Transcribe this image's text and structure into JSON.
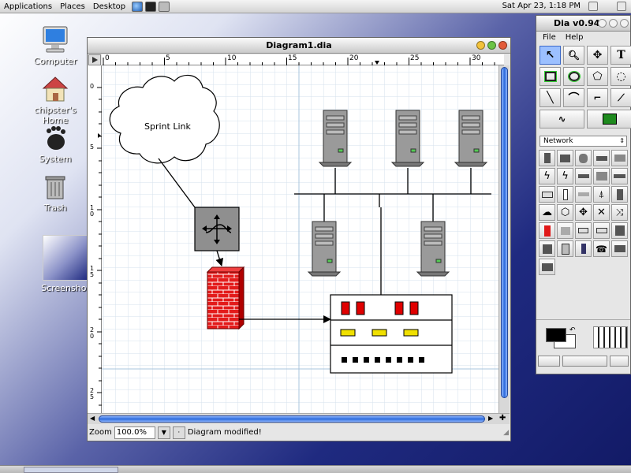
{
  "panel": {
    "menus": [
      "Applications",
      "Places",
      "Desktop"
    ],
    "clock": "Sat Apr 23,  1:18 PM"
  },
  "desktop_icons": [
    {
      "label": "Computer"
    },
    {
      "label": "chipster's Home"
    },
    {
      "label": "System"
    },
    {
      "label": "Trash"
    },
    {
      "label": "Screenshot"
    }
  ],
  "diagram_window": {
    "title": "Diagram1.dia",
    "ruler_top": [
      "0",
      "5",
      "10",
      "15",
      "20",
      "25",
      "30"
    ],
    "ruler_left": [
      "0",
      "5",
      "1\n0",
      "1\n5",
      "2\n0",
      "2\n5"
    ],
    "canvas": {
      "cloud_label": "Sprint Link"
    },
    "status": {
      "zoom_label": "Zoom",
      "zoom_value": "100.0%",
      "message": "Diagram modified!"
    }
  },
  "toolbox": {
    "title": "Dia v0.94",
    "menus": [
      "File",
      "Help"
    ],
    "sheet": "Network",
    "tools": [
      "pointer",
      "magnify",
      "move",
      "text",
      "box",
      "ellipse",
      "polygon",
      "beziergon",
      "line",
      "arc",
      "zigzag",
      "polyline",
      "bezier",
      "image"
    ]
  },
  "colors": {
    "accent": "#2c6bdc",
    "firewall": "#e01818",
    "router": "#8a8a8a",
    "indicator_red": "#e00000",
    "indicator_yellow": "#f0e000"
  }
}
